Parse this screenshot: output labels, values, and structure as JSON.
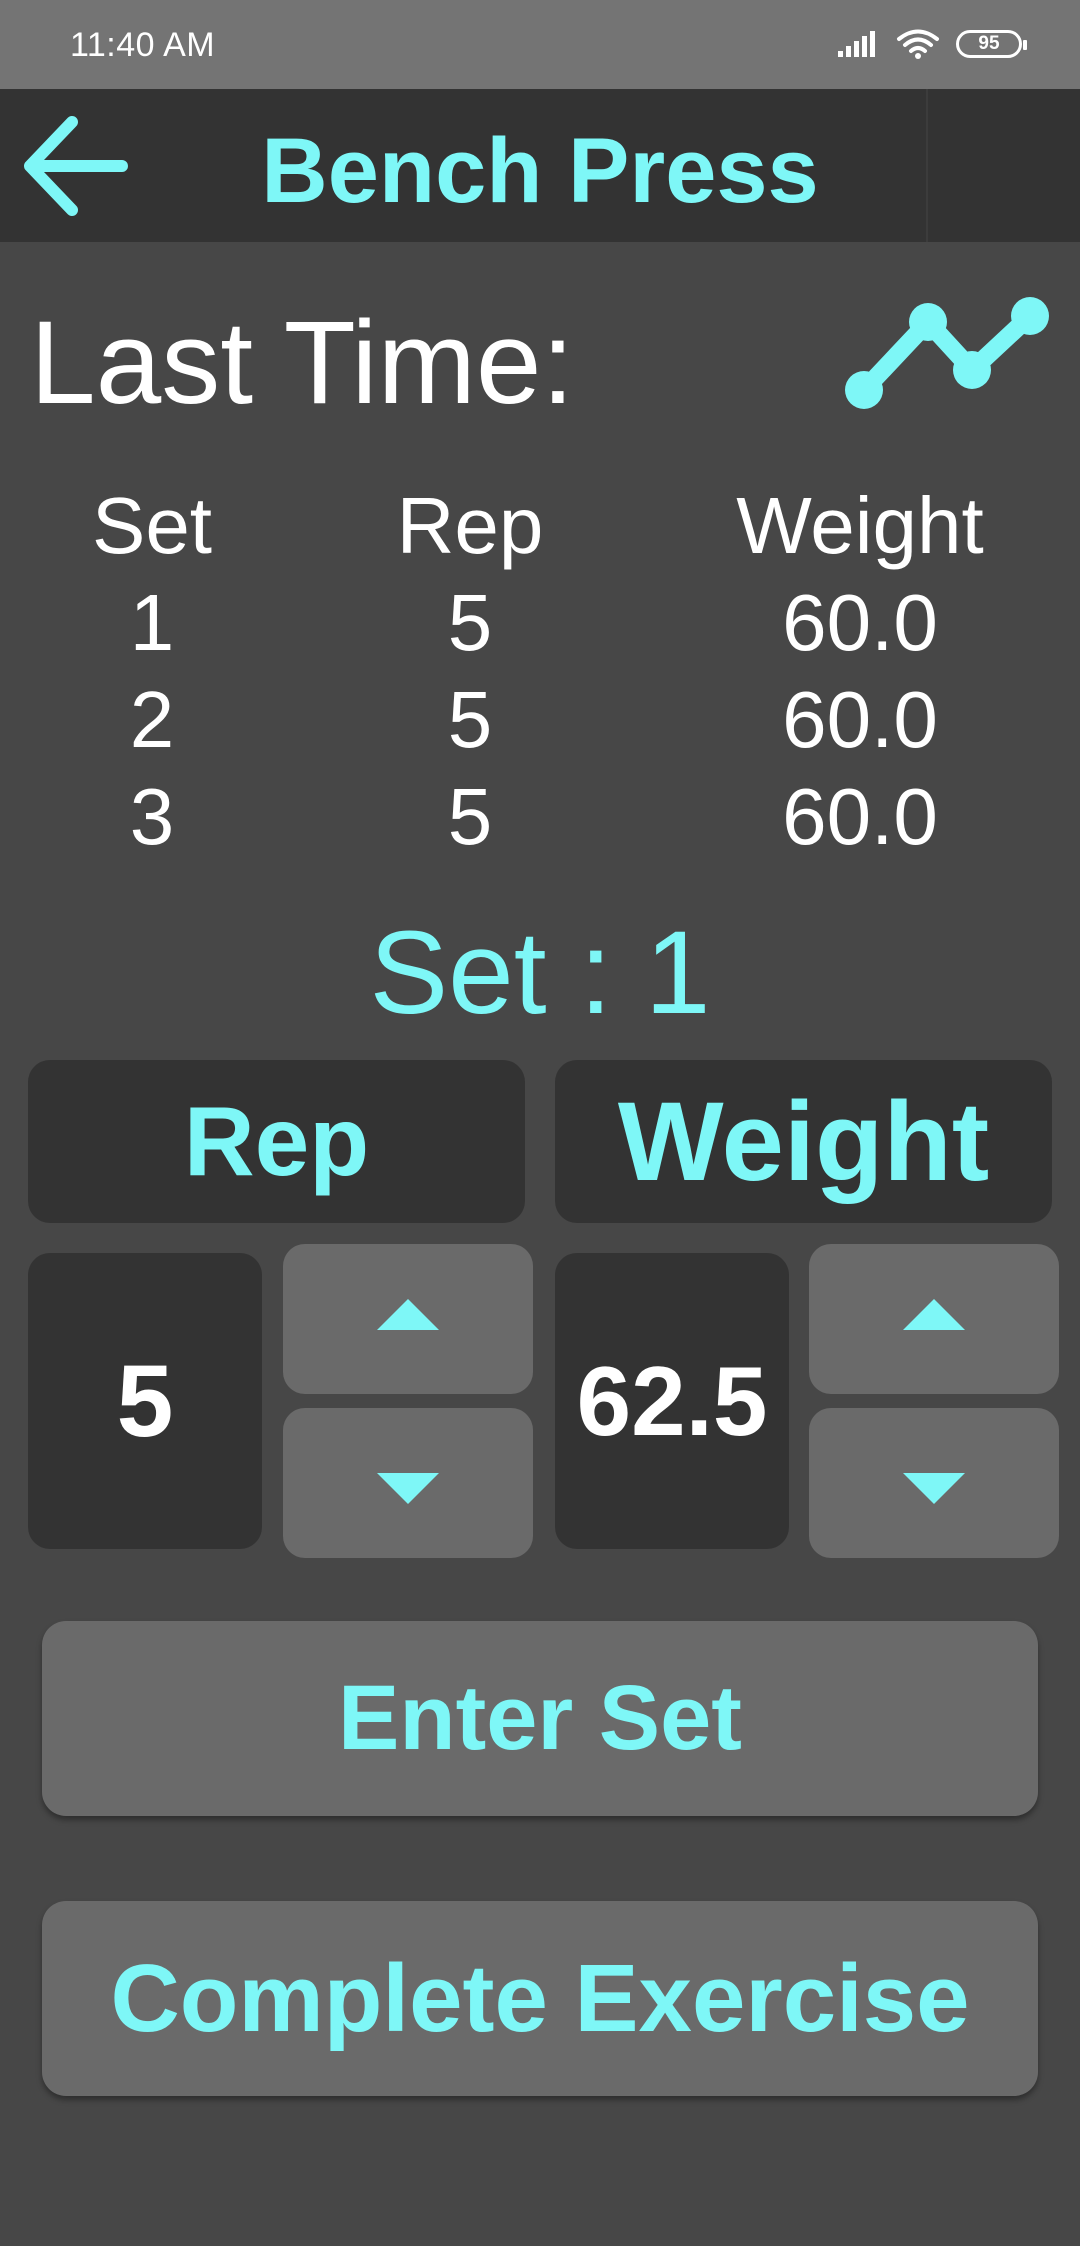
{
  "status_bar": {
    "time": "11:40 AM",
    "battery": "95"
  },
  "header": {
    "title": "Bench Press",
    "back_icon": "arrow-left-icon"
  },
  "last_time": {
    "label": "Last Time:",
    "stats_icon": "line-chart-icon",
    "columns": [
      "Set",
      "Rep",
      "Weight"
    ],
    "rows": [
      [
        "1",
        "5",
        "60.0"
      ],
      [
        "2",
        "5",
        "60.0"
      ],
      [
        "3",
        "5",
        "60.0"
      ]
    ]
  },
  "current_set": {
    "label": "Set : 1"
  },
  "inputs": {
    "rep_label": "Rep",
    "weight_label": "Weight",
    "rep_value": "5",
    "weight_value": "62.5",
    "increment_icon": "triangle-up-icon",
    "decrement_icon": "triangle-down-icon"
  },
  "actions": {
    "enter_set": "Enter Set",
    "complete_exercise": "Complete Exercise"
  },
  "colors": {
    "accent": "#7ef7f7",
    "background": "#474747",
    "panel": "#333333",
    "button": "#6a6a6a",
    "status_bar": "#747474"
  }
}
